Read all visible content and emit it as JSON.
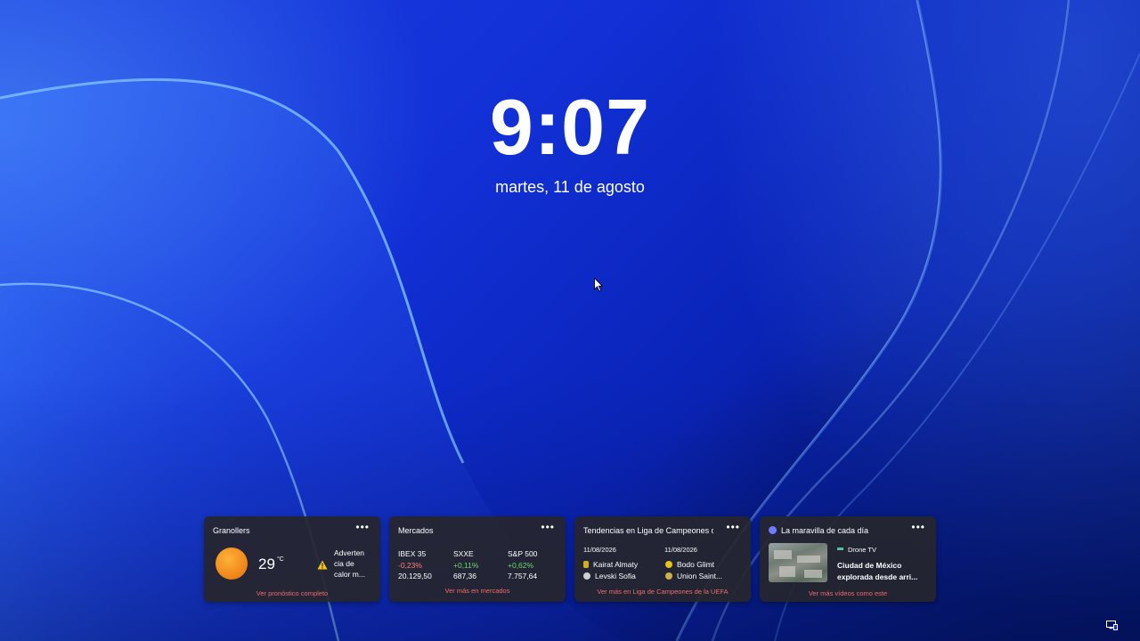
{
  "lockscreen": {
    "time": "9:07",
    "date": "martes, 11 de agosto"
  },
  "weather": {
    "location": "Granollers",
    "temperature": "29",
    "unit": "°C",
    "alert": "Advertencia de calor m...",
    "alert_lines": [
      "Adverten",
      "cia de",
      "calor m..."
    ],
    "link": "Ver pronóstico completo"
  },
  "markets": {
    "title": "Mercados",
    "indices": [
      {
        "name": "IBEX 35",
        "change": "-0,23%",
        "value": "20.129,50"
      },
      {
        "name": "SXXE",
        "change": "+0,11%",
        "value": "687,36"
      },
      {
        "name": "S&P 500",
        "change": "+0,62%",
        "value": "7.757,64"
      }
    ],
    "link": "Ver más en mercados"
  },
  "sports": {
    "title": "Tendencias en Liga de Campeones de la UEFA",
    "matches": [
      {
        "date": "11/08/2026",
        "home": "Kairat Almaty",
        "away": "Levski Sofia"
      },
      {
        "date": "11/08/2026",
        "home": "Bodo Glimt",
        "away": "Union Saint..."
      }
    ],
    "link": "Ver más en Liga de Campeones de la UEFA"
  },
  "video": {
    "title": "La maravilla de cada día",
    "source": "Drone TV",
    "headline": "Ciudad de México explorada desde arri...",
    "headline_lines": [
      "Ciudad de México",
      "explorada desde arri..."
    ],
    "link": "Ver más vídeos como este"
  },
  "icons": {
    "weather": "sun-icon",
    "alert": "warning-icon",
    "more": "more-options-icon",
    "cursor": "mouse-pointer-icon",
    "tray": "network-icon"
  },
  "colors": {
    "negative": "#ff7b7b",
    "positive": "#6cd66c",
    "link": "#f06a6a",
    "alert": "#f5c518"
  }
}
